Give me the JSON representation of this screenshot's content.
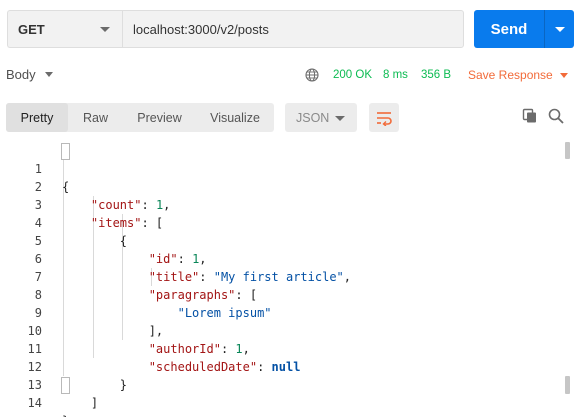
{
  "request": {
    "method": "GET",
    "url": "localhost:3000/v2/posts",
    "send_label": "Send"
  },
  "response": {
    "body_tab": "Body",
    "status": "200 OK",
    "time": "8 ms",
    "size": "356 B",
    "save_label": "Save Response"
  },
  "toolbar": {
    "views": [
      "Pretty",
      "Raw",
      "Preview",
      "Visualize"
    ],
    "active_view": "Pretty",
    "format": "JSON"
  },
  "code_lines": [
    {
      "num": "1"
    },
    {
      "num": "2"
    },
    {
      "num": "3"
    },
    {
      "num": "4"
    },
    {
      "num": "5"
    },
    {
      "num": "6"
    },
    {
      "num": "7"
    },
    {
      "num": "8"
    },
    {
      "num": "9"
    },
    {
      "num": "10"
    },
    {
      "num": "11"
    },
    {
      "num": "12"
    },
    {
      "num": "13"
    },
    {
      "num": "14"
    }
  ],
  "json": {
    "count_key": "\"count\"",
    "count_val": "1",
    "items_key": "\"items\"",
    "id_key": "\"id\"",
    "id_val": "1",
    "title_key": "\"title\"",
    "title_val": "\"My first article\"",
    "paragraphs_key": "\"paragraphs\"",
    "paragraph_0": "\"Lorem ipsum\"",
    "authorId_key": "\"authorId\"",
    "authorId_val": "1",
    "scheduledDate_key": "\"scheduledDate\"",
    "scheduledDate_val": "null"
  },
  "colors": {
    "send_button": "#097bed",
    "status_ok": "#0cbb52",
    "save_response": "#f26b3a",
    "json_key": "#a31515",
    "json_string": "#0451a5",
    "json_number": "#098658"
  },
  "icons": {
    "globe": "globe-icon",
    "wrap": "wrap-lines-icon",
    "copy": "copy-icon",
    "search": "search-icon"
  }
}
